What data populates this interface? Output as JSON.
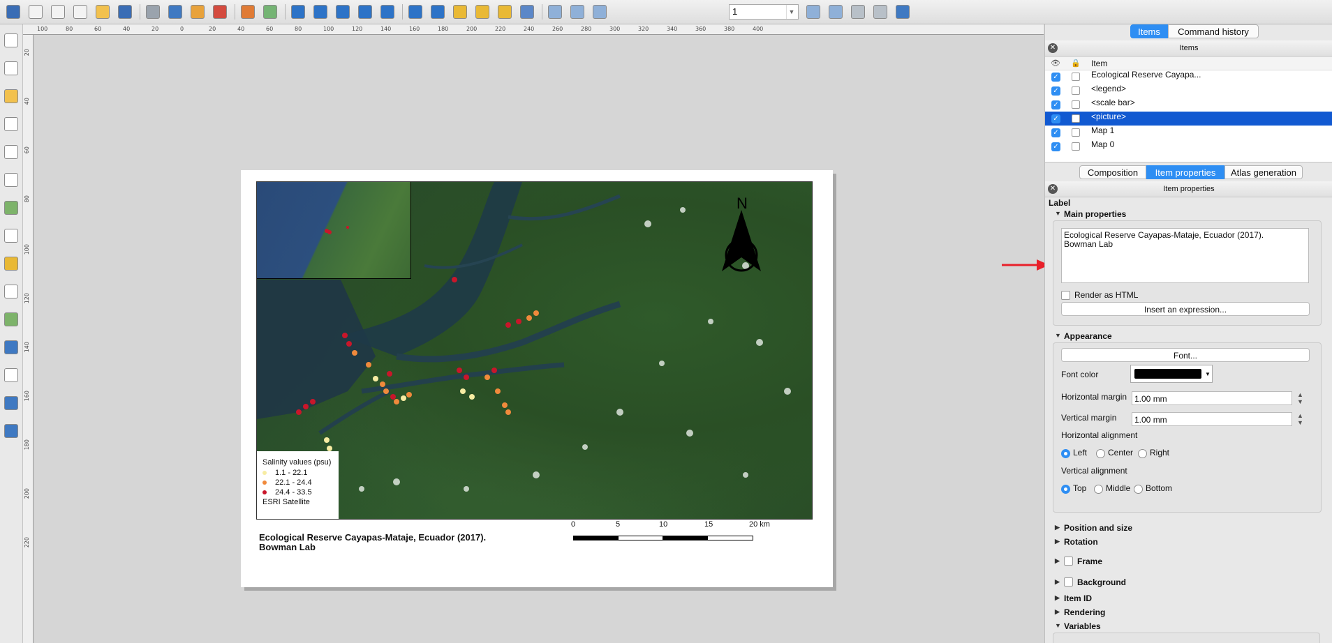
{
  "toolbar": {
    "page_number": "1"
  },
  "ruler": {
    "h_ticks": [
      "100",
      "80",
      "60",
      "40",
      "20",
      "0",
      "20",
      "40",
      "60",
      "80",
      "100",
      "120",
      "140",
      "160",
      "180",
      "200",
      "220",
      "240",
      "260",
      "280",
      "300",
      "320",
      "340",
      "360",
      "380",
      "400"
    ],
    "v_ticks": [
      "20",
      "40",
      "60",
      "80",
      "100",
      "120",
      "140",
      "160",
      "180",
      "200",
      "220"
    ]
  },
  "composition": {
    "inset_label": "",
    "north_letter": "N",
    "legend": {
      "title": "Salinity values (psu)",
      "items": [
        {
          "label": "1.1 - 22.1",
          "color": "#f7eca3"
        },
        {
          "label": "22.1 - 24.4",
          "color": "#f08a3c"
        },
        {
          "label": "24.4 - 33.5",
          "color": "#c9162a"
        }
      ],
      "source": "ESRI Satellite"
    },
    "title_line1": "Ecological Reserve Cayapas-Mataje, Ecuador (2017).",
    "title_line2": "Bowman Lab",
    "scalebar": {
      "labels": [
        "0",
        "5",
        "10",
        "15",
        "20 km"
      ]
    }
  },
  "panel": {
    "top_tabs": [
      {
        "label": "Items",
        "active": true
      },
      {
        "label": "Command history",
        "active": false
      }
    ],
    "items_dock_title": "Items",
    "items_column": "Item",
    "items": [
      {
        "label": "Ecological Reserve Cayapa...",
        "selected": false
      },
      {
        "label": "<legend>",
        "selected": false
      },
      {
        "label": "<scale bar>",
        "selected": false
      },
      {
        "label": "<picture>",
        "selected": true
      },
      {
        "label": "Map 1",
        "selected": false
      },
      {
        "label": "Map 0",
        "selected": false
      }
    ],
    "mid_tabs": [
      {
        "label": "Composition",
        "active": false
      },
      {
        "label": "Item properties",
        "active": true
      },
      {
        "label": "Atlas generation",
        "active": false
      }
    ],
    "props_dock_title": "Item properties",
    "item_type": "Label",
    "main_properties": {
      "header": "Main properties",
      "text": "Ecological Reserve Cayapas-Mataje, Ecuador (2017).\nBowman Lab",
      "render_html_label": "Render as HTML",
      "insert_expression": "Insert an expression..."
    },
    "appearance": {
      "header": "Appearance",
      "font_button": "Font...",
      "font_color_label": "Font color",
      "font_color": "#000000",
      "h_margin_label": "Horizontal margin",
      "h_margin_value": "1.00 mm",
      "v_margin_label": "Vertical margin",
      "v_margin_value": "1.00 mm",
      "h_align_label": "Horizontal alignment",
      "h_align_options": [
        "Left",
        "Center",
        "Right"
      ],
      "h_align_selected": "Left",
      "v_align_label": "Vertical alignment",
      "v_align_options": [
        "Top",
        "Middle",
        "Bottom"
      ],
      "v_align_selected": "Top"
    },
    "collapsed_sections": [
      "Position and size",
      "Rotation",
      "Frame",
      "Background",
      "Item ID",
      "Rendering"
    ],
    "variables_header": "Variables"
  }
}
